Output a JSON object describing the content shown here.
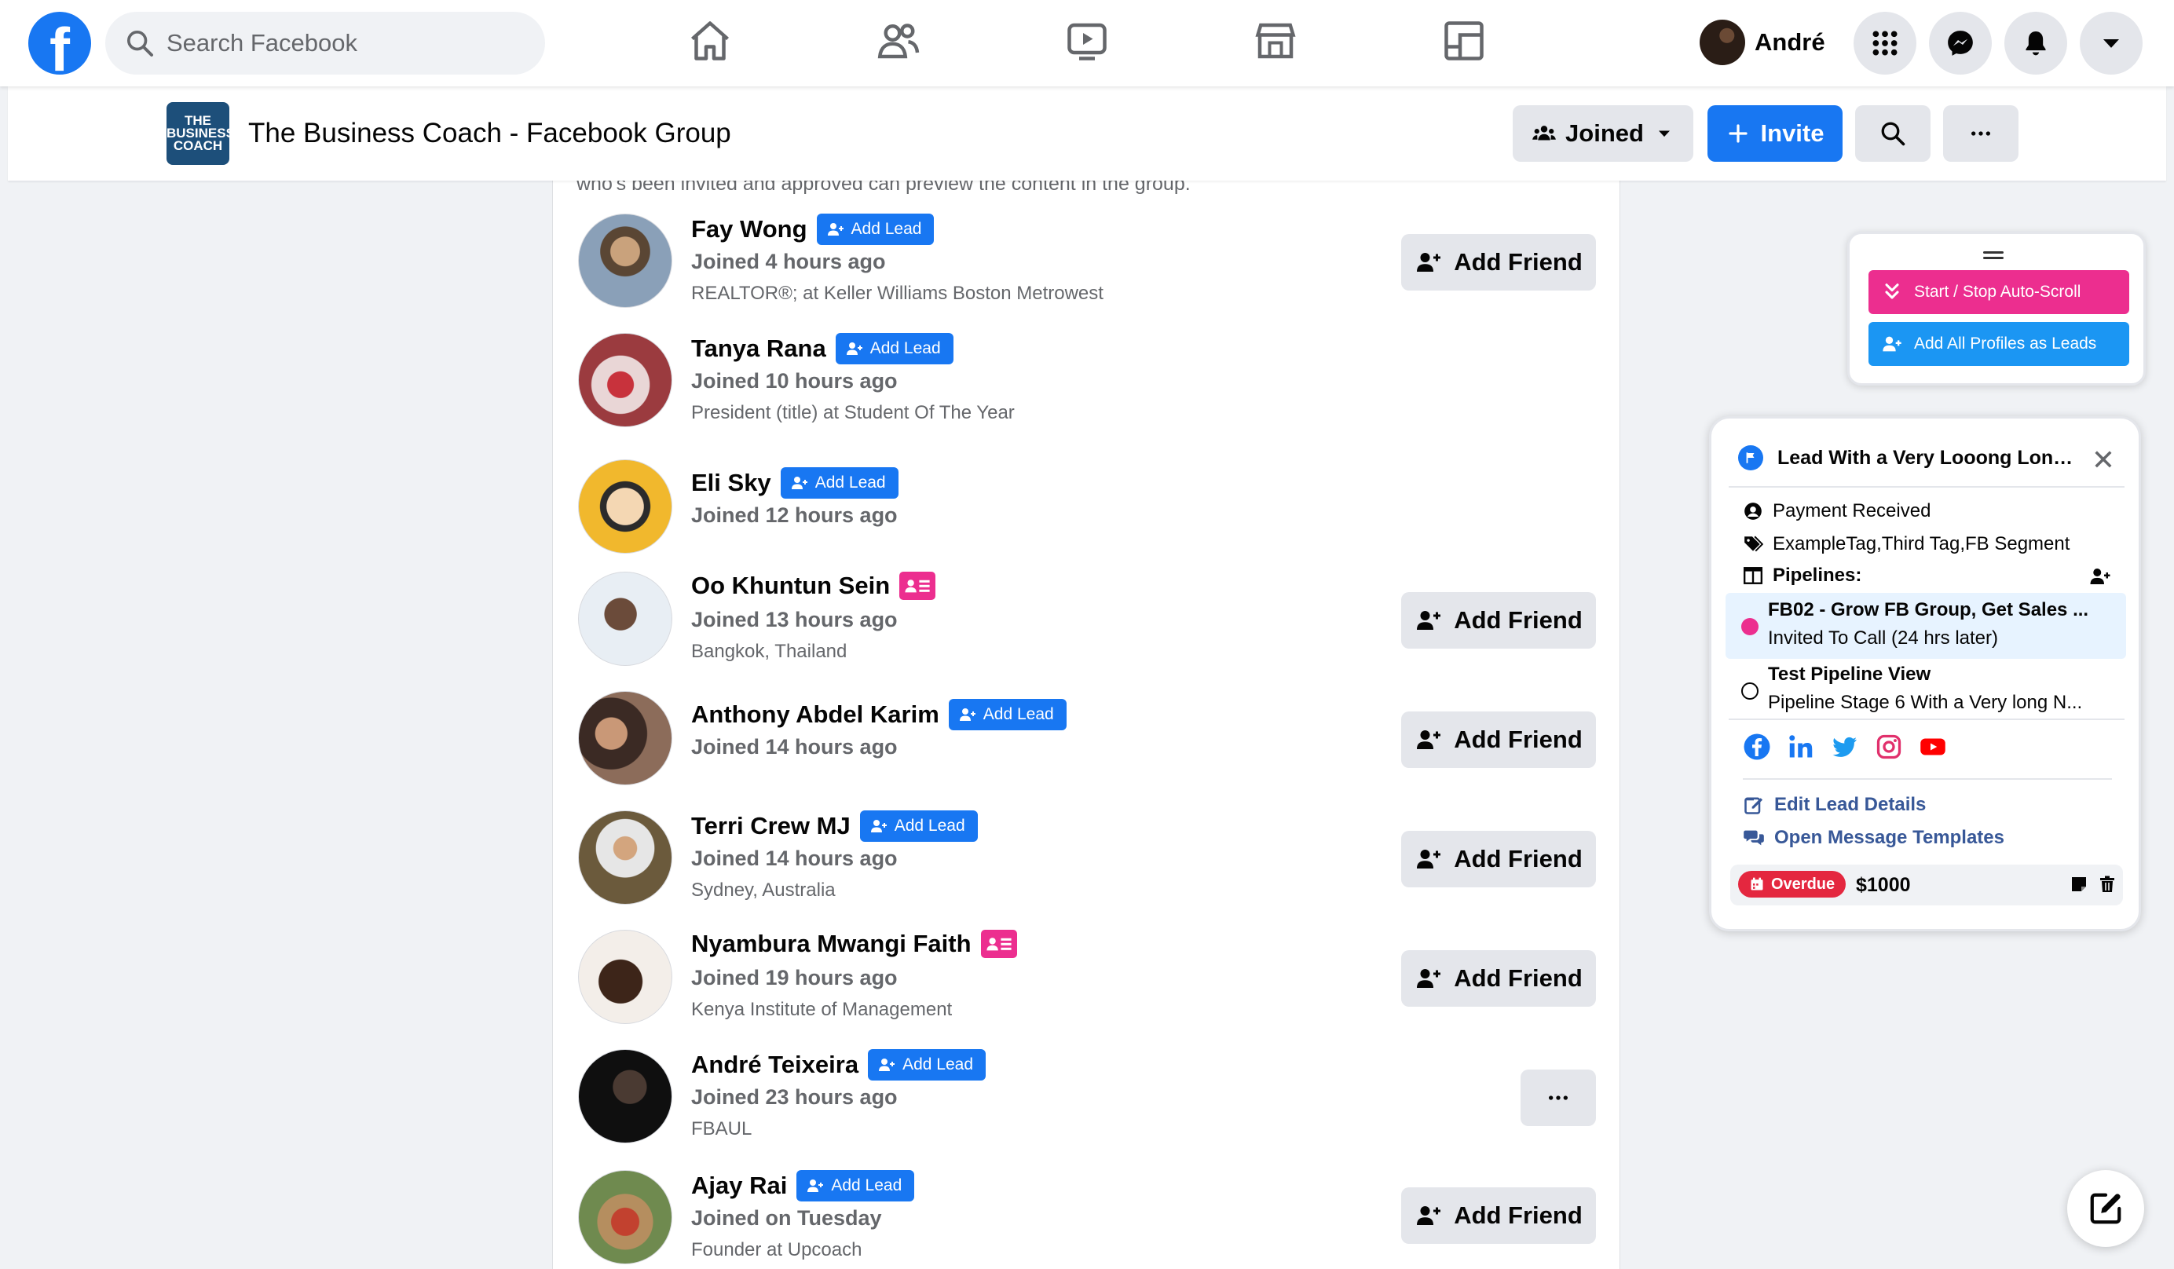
{
  "topnav": {
    "search_placeholder": "Search Facebook",
    "profile_name": "André",
    "nav_icons": [
      "home-icon",
      "friends-icon",
      "watch-icon",
      "marketplace-icon",
      "gaming-icon"
    ],
    "right_icons": [
      "menu-grid-icon",
      "messenger-icon",
      "bell-icon",
      "caret-down-icon"
    ]
  },
  "group": {
    "logo_text": "THE BUSINESS COACH",
    "title": "The Business Coach - Facebook Group",
    "joined_label": "Joined",
    "invite_label": "Invite"
  },
  "list": {
    "cut_text": "who's been invited and approved can preview the content in the group.",
    "add_lead_label": "Add Lead",
    "add_friend_label": "Add Friend",
    "members": [
      {
        "name": "Fay Wong",
        "joined": "Joined 4 hours ago",
        "sub": "REALTOR®; at Keller Williams Boston Metrowest",
        "badge": "add-lead",
        "action": "add-friend"
      },
      {
        "name": "Tanya Rana",
        "joined": "Joined 10 hours ago",
        "sub": "President (title) at Student Of The Year",
        "badge": "add-lead",
        "action": "none"
      },
      {
        "name": "Eli Sky",
        "joined": "Joined 12 hours ago",
        "sub": "",
        "badge": "add-lead",
        "action": "none"
      },
      {
        "name": "Oo Khuntun Sein",
        "joined": "Joined 13 hours ago",
        "sub": "Bangkok, Thailand",
        "badge": "lead-card",
        "action": "add-friend"
      },
      {
        "name": "Anthony Abdel Karim",
        "joined": "Joined 14 hours ago",
        "sub": "",
        "badge": "add-lead",
        "action": "add-friend"
      },
      {
        "name": "Terri Crew MJ",
        "joined": "Joined 14 hours ago",
        "sub": "Sydney, Australia",
        "badge": "add-lead",
        "action": "add-friend"
      },
      {
        "name": "Nyambura Mwangi Faith",
        "joined": "Joined 19 hours ago",
        "sub": "Kenya Institute of Management",
        "badge": "lead-card",
        "action": "add-friend"
      },
      {
        "name": "André Teixeira",
        "joined": "Joined 23 hours ago",
        "sub": "FBAUL",
        "badge": "add-lead",
        "action": "more"
      },
      {
        "name": "Ajay Rai",
        "joined": "Joined on Tuesday",
        "sub": "Founder at Upcoach",
        "badge": "add-lead",
        "action": "add-friend"
      }
    ]
  },
  "scroll_widget": {
    "autoscroll_label": "Start / Stop Auto-Scroll",
    "add_all_label": "Add All Profiles as Leads",
    "autoscroll_color": "#ec2e8f",
    "add_all_color": "#1b96f3"
  },
  "lead_panel": {
    "title": "Lead With a Very Looong Long ...",
    "status": "Payment Received",
    "tags": "ExampleTag,Third Tag,FB Segment",
    "pipelines_label": "Pipelines:",
    "pipelines": [
      {
        "name": "FB02 - Grow FB Group, Get Sales ...",
        "stage": "Invited To Call (24 hrs later)"
      },
      {
        "name": "Test Pipeline View",
        "stage": "Pipeline Stage 6 With a Very long N..."
      }
    ],
    "edit_label": "Edit Lead Details",
    "templates_label": "Open Message Templates",
    "overdue_label": "Overdue",
    "amount": "$1000",
    "pink_color": "#ec2e8f"
  }
}
